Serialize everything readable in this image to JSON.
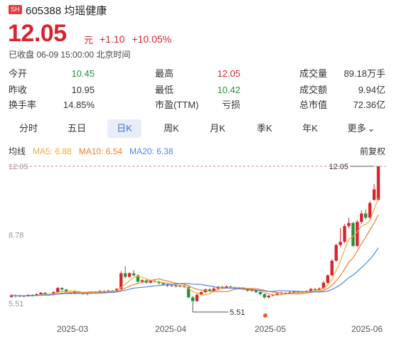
{
  "header": {
    "exchange": "SH",
    "code_name": "605388 均瑶健康",
    "price": "12.05",
    "unit": "元",
    "change": "+1.10",
    "change_pct": "+10.05%",
    "status": "已收盘 06-09 15:00:00 北京时间"
  },
  "stats": [
    {
      "label": "今开",
      "value": "10.45",
      "color": "green"
    },
    {
      "label": "最高",
      "value": "12.05",
      "color": "red"
    },
    {
      "label": "成交量",
      "value": "89.18万手",
      "color": "dark"
    },
    {
      "label": "昨收",
      "value": "10.95",
      "color": "dark"
    },
    {
      "label": "最低",
      "value": "10.42",
      "color": "green"
    },
    {
      "label": "成交额",
      "value": "9.94亿",
      "color": "dark"
    },
    {
      "label": "换手率",
      "value": "14.85%",
      "color": "dark"
    },
    {
      "label": "市盈(TTM)",
      "value": "亏损",
      "color": "dark"
    },
    {
      "label": "总市值",
      "value": "72.36亿",
      "color": "dark"
    }
  ],
  "tabs": [
    "分时",
    "五日",
    "日K",
    "周K",
    "月K",
    "季K",
    "年K",
    "更多"
  ],
  "active_tab": "日K",
  "legend": {
    "title": "均线",
    "ma5": "MA5: 6.88",
    "ma10": "MA10: 6.54",
    "ma20": "MA20: 6.38",
    "adjust": "前复权"
  },
  "colors": {
    "up": "#d9242e",
    "down": "#2a8f3a",
    "ma5": "#f2a93b",
    "ma10": "#ef7d2c",
    "ma20": "#4f86e8"
  },
  "chart_data": {
    "type": "candlestick",
    "y_tick_labels": [
      "12.05",
      "8.78",
      "5.51"
    ],
    "ylim": [
      5.2,
      12.3
    ],
    "x_tick_labels": [
      "2025-03",
      "2025-04",
      "2025-05",
      "2025-06"
    ],
    "annotations": {
      "high_label": "12.05",
      "low_label": "5.51"
    },
    "candles": [
      [
        5.82,
        5.9,
        5.78,
        5.95
      ],
      [
        5.9,
        5.86,
        5.8,
        5.94
      ],
      [
        5.86,
        5.88,
        5.82,
        5.92
      ],
      [
        5.88,
        5.85,
        5.8,
        5.91
      ],
      [
        5.85,
        5.92,
        5.83,
        5.96
      ],
      [
        5.92,
        5.88,
        5.84,
        5.95
      ],
      [
        5.88,
        5.95,
        5.86,
        6.0
      ],
      [
        5.95,
        6.02,
        5.9,
        6.06
      ],
      [
        6.02,
        5.96,
        5.92,
        6.05
      ],
      [
        5.96,
        5.92,
        5.88,
        5.99
      ],
      [
        5.92,
        6.05,
        5.9,
        6.1
      ],
      [
        6.05,
        6.25,
        6.0,
        6.3
      ],
      [
        6.25,
        6.18,
        6.1,
        6.28
      ],
      [
        6.18,
        6.05,
        6.0,
        6.2
      ],
      [
        6.05,
        6.0,
        5.95,
        6.08
      ],
      [
        6.0,
        6.08,
        5.96,
        6.12
      ],
      [
        6.08,
        6.02,
        5.98,
        6.1
      ],
      [
        6.02,
        5.96,
        5.92,
        6.04
      ],
      [
        5.96,
        6.0,
        5.9,
        6.05
      ],
      [
        6.0,
        6.06,
        5.97,
        6.09
      ],
      [
        6.06,
        6.03,
        5.98,
        6.1
      ],
      [
        6.03,
        6.1,
        6.0,
        6.14
      ],
      [
        6.1,
        6.05,
        6.02,
        6.13
      ],
      [
        6.05,
        6.12,
        6.03,
        6.16
      ],
      [
        6.12,
        6.08,
        6.04,
        6.15
      ],
      [
        6.08,
        6.2,
        6.06,
        6.25
      ],
      [
        6.2,
        6.95,
        6.18,
        7.05
      ],
      [
        6.95,
        6.78,
        6.7,
        7.3
      ],
      [
        6.78,
        6.95,
        6.75,
        7.0
      ],
      [
        6.95,
        6.85,
        6.8,
        7.1
      ],
      [
        6.85,
        6.55,
        6.5,
        6.9
      ],
      [
        6.55,
        6.62,
        6.48,
        6.68
      ],
      [
        6.62,
        6.5,
        6.45,
        6.66
      ],
      [
        6.5,
        6.58,
        6.46,
        6.62
      ],
      [
        6.58,
        6.55,
        6.5,
        6.64
      ],
      [
        6.55,
        6.48,
        6.42,
        6.6
      ],
      [
        6.48,
        6.42,
        6.36,
        6.52
      ],
      [
        6.42,
        6.35,
        6.3,
        6.46
      ],
      [
        6.35,
        6.38,
        6.3,
        6.42
      ],
      [
        6.38,
        6.32,
        6.28,
        6.42
      ],
      [
        6.32,
        6.36,
        6.28,
        6.4
      ],
      [
        6.36,
        6.3,
        6.24,
        6.4
      ],
      [
        6.3,
        5.8,
        5.76,
        6.32
      ],
      [
        5.8,
        5.62,
        5.51,
        5.88
      ],
      [
        5.62,
        5.92,
        5.6,
        5.98
      ],
      [
        5.92,
        6.05,
        5.88,
        6.1
      ],
      [
        6.05,
        6.18,
        6.0,
        6.22
      ],
      [
        6.18,
        6.1,
        6.05,
        6.24
      ],
      [
        6.1,
        6.22,
        6.08,
        6.28
      ],
      [
        6.22,
        6.3,
        6.15,
        6.35
      ],
      [
        6.3,
        6.25,
        6.2,
        6.36
      ],
      [
        6.25,
        6.32,
        6.22,
        6.38
      ],
      [
        6.32,
        6.28,
        6.22,
        6.36
      ],
      [
        6.28,
        6.22,
        6.18,
        6.32
      ],
      [
        6.22,
        6.26,
        6.18,
        6.3
      ],
      [
        6.26,
        6.2,
        6.14,
        6.3
      ],
      [
        6.2,
        6.12,
        6.06,
        6.24
      ],
      [
        6.12,
        6.15,
        6.08,
        6.2
      ],
      [
        6.15,
        6.05,
        6.0,
        6.18
      ],
      [
        6.05,
        5.95,
        5.9,
        6.08
      ],
      [
        5.95,
        5.8,
        5.74,
        5.98
      ],
      [
        5.8,
        5.88,
        5.76,
        5.92
      ],
      [
        5.88,
        5.92,
        5.84,
        5.96
      ],
      [
        5.92,
        5.98,
        5.88,
        6.02
      ],
      [
        5.98,
        6.02,
        5.94,
        6.06
      ],
      [
        6.02,
        5.98,
        5.95,
        6.05
      ],
      [
        5.98,
        6.04,
        5.96,
        6.08
      ],
      [
        6.04,
        6.08,
        6.0,
        6.12
      ],
      [
        6.08,
        6.02,
        5.98,
        6.1
      ],
      [
        6.02,
        6.06,
        5.98,
        6.1
      ],
      [
        6.06,
        6.1,
        6.03,
        6.14
      ],
      [
        6.1,
        6.2,
        6.08,
        6.25
      ],
      [
        6.2,
        6.15,
        6.1,
        6.24
      ],
      [
        6.15,
        6.22,
        6.12,
        6.28
      ],
      [
        6.22,
        6.5,
        6.2,
        6.58
      ],
      [
        6.5,
        6.85,
        6.45,
        6.9
      ],
      [
        6.85,
        7.55,
        6.82,
        7.62
      ],
      [
        7.55,
        8.3,
        7.5,
        8.35
      ],
      [
        8.3,
        8.45,
        8.2,
        9.1
      ],
      [
        8.45,
        9.2,
        8.4,
        9.3
      ],
      [
        9.2,
        9.35,
        9.1,
        9.6
      ],
      [
        9.35,
        8.25,
        8.2,
        9.4
      ],
      [
        8.25,
        9.4,
        8.2,
        9.5
      ],
      [
        9.4,
        9.8,
        9.3,
        9.95
      ],
      [
        9.8,
        9.6,
        9.5,
        10.0
      ],
      [
        9.6,
        10.3,
        9.55,
        10.4
      ],
      [
        10.45,
        10.95,
        10.42,
        11.2
      ],
      [
        10.45,
        12.05,
        10.42,
        12.05
      ]
    ],
    "ma5_end": 6.88,
    "ma10_end": 6.54,
    "ma20_end": 6.38
  }
}
